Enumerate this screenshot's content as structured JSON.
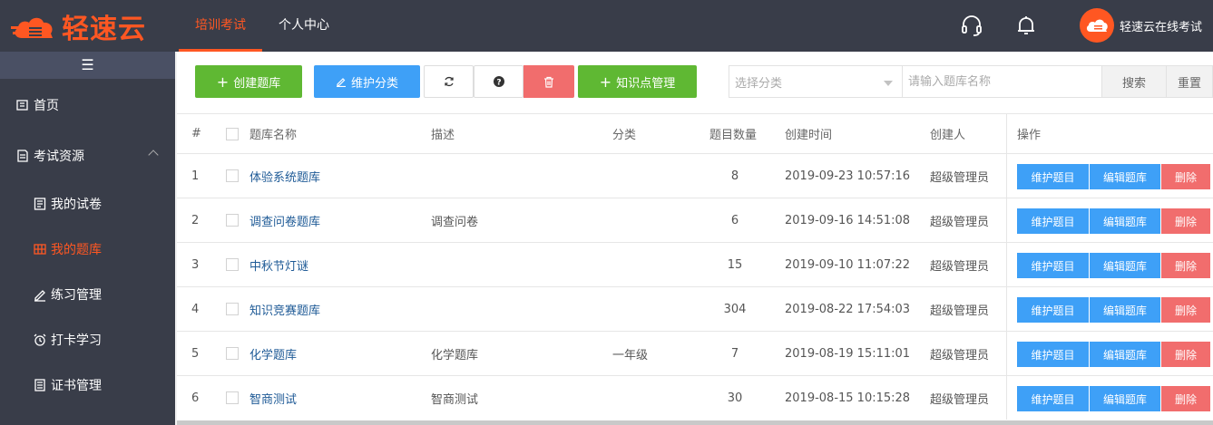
{
  "brand": {
    "name": "轻速云",
    "color": "#ff5722"
  },
  "topnav": {
    "items": [
      {
        "label": "培训考试",
        "active": true
      },
      {
        "label": "个人中心",
        "active": false
      }
    ]
  },
  "topbar_icons": [
    "headset-icon",
    "bell-icon"
  ],
  "user": {
    "name": "轻速云在线考试"
  },
  "sidebar": {
    "toggle_icon": "hamburger-icon",
    "items": [
      {
        "label": "首页",
        "icon": "home-icon",
        "level": 1
      },
      {
        "label": "考试资源",
        "icon": "document-icon",
        "level": 1,
        "expanded": true
      },
      {
        "label": "我的试卷",
        "icon": "paper-icon",
        "level": 2
      },
      {
        "label": "我的题库",
        "icon": "grid-icon",
        "level": 2,
        "active": true
      },
      {
        "label": "练习管理",
        "icon": "pen-icon",
        "level": 2
      },
      {
        "label": "打卡学习",
        "icon": "alarm-icon",
        "level": 2
      },
      {
        "label": "证书管理",
        "icon": "certificate-icon",
        "level": 2
      }
    ]
  },
  "toolbar": {
    "create_label": "创建题库",
    "maintain_category_label": "维护分类",
    "knowledge_label": "知识点管理",
    "category_placeholder": "选择分类",
    "search_placeholder": "请输入题库名称",
    "search_label": "搜索",
    "reset_label": "重置"
  },
  "table": {
    "headers": {
      "index": "#",
      "name": "题库名称",
      "desc": "描述",
      "category": "分类",
      "count": "题目数量",
      "created": "创建时间",
      "creator": "创建人",
      "ops": "操作"
    },
    "ops": {
      "maintain": "维护题目",
      "edit": "编辑题库",
      "delete": "删除"
    },
    "rows": [
      {
        "index": "1",
        "name": "体验系统题库",
        "desc": "",
        "category": "",
        "count": "8",
        "created": "2019-09-23 10:57:16",
        "creator": "超级管理员"
      },
      {
        "index": "2",
        "name": "调查问卷题库",
        "desc": "调查问卷",
        "category": "",
        "count": "6",
        "created": "2019-09-16 14:51:08",
        "creator": "超级管理员"
      },
      {
        "index": "3",
        "name": "中秋节灯谜",
        "desc": "",
        "category": "",
        "count": "15",
        "created": "2019-09-10 11:07:22",
        "creator": "超级管理员"
      },
      {
        "index": "4",
        "name": "知识竞赛题库",
        "desc": "",
        "category": "",
        "count": "304",
        "created": "2019-08-22 17:54:03",
        "creator": "超级管理员"
      },
      {
        "index": "5",
        "name": "化学题库",
        "desc": "化学题库",
        "category": "一年级",
        "count": "7",
        "created": "2019-08-19 15:11:01",
        "creator": "超级管理员"
      },
      {
        "index": "6",
        "name": "智商测试",
        "desc": "智商测试",
        "category": "",
        "count": "30",
        "created": "2019-08-15 10:15:28",
        "creator": "超级管理员"
      }
    ]
  }
}
